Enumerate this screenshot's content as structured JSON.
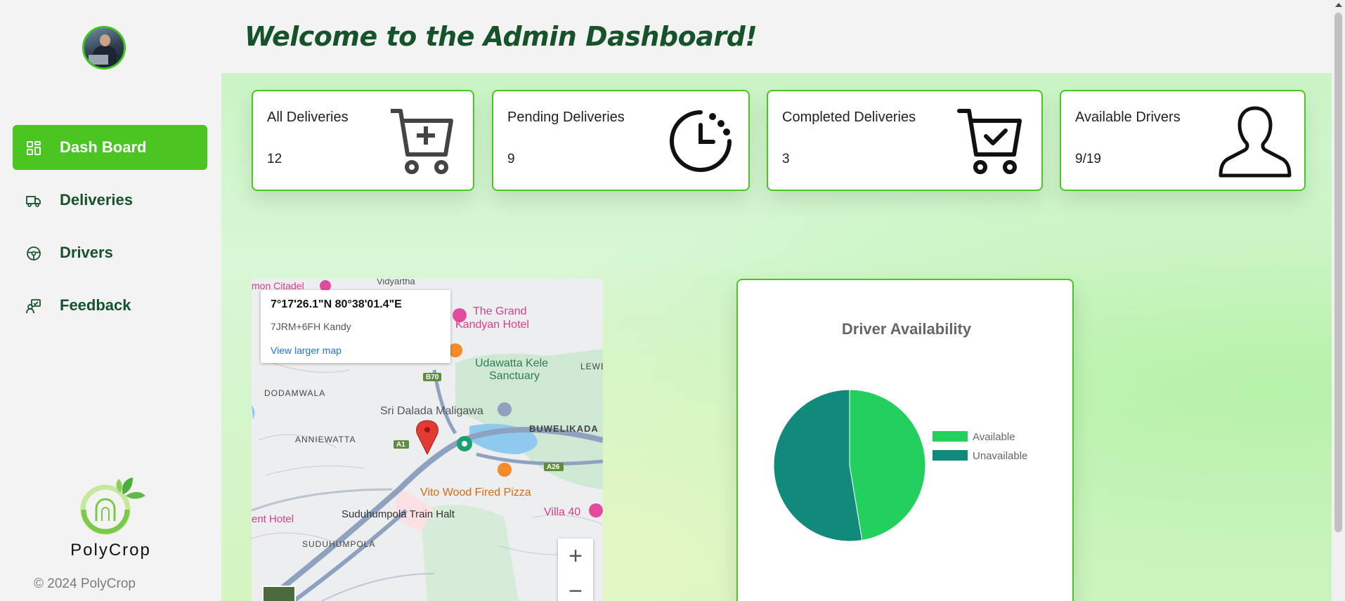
{
  "sidebar": {
    "nav": [
      {
        "label": "Dash Board",
        "icon": "dashboard-grid-icon",
        "active": true
      },
      {
        "label": "Deliveries",
        "icon": "truck-icon",
        "active": false
      },
      {
        "label": "Drivers",
        "icon": "steering-wheel-icon",
        "active": false
      },
      {
        "label": "Feedback",
        "icon": "feedback-person-icon",
        "active": false
      }
    ],
    "brand_name": "PolyCrop",
    "copyright": "© 2024 PolyCrop"
  },
  "header": {
    "title": "Welcome to the Admin Dashboard!"
  },
  "cards": [
    {
      "title": "All Deliveries",
      "value": "12",
      "icon": "cart-plus-icon"
    },
    {
      "title": "Pending Deliveries",
      "value": "9",
      "icon": "clock-icon"
    },
    {
      "title": "Completed Deliveries",
      "value": "3",
      "icon": "cart-check-icon"
    },
    {
      "title": "Available Drivers",
      "value": "9/19",
      "icon": "user-icon"
    }
  ],
  "map": {
    "coords": "7°17'26.1\"N 80°38'01.4\"E",
    "plus_code": "7JRM+6FH Kandy",
    "link": "View larger map",
    "zoom_in": "+",
    "zoom_out": "−",
    "labels": [
      {
        "text": "mon Citadel",
        "color": "#d6408b"
      },
      {
        "text": "Vidyartha",
        "color": "#555"
      },
      {
        "text": "The Grand",
        "color": "#d6408b"
      },
      {
        "text": "Kandyan Hotel",
        "color": "#d6408b"
      },
      {
        "text": "Udawatta Kele",
        "color": "#2f7d4f"
      },
      {
        "text": "Sanctuary",
        "color": "#2f7d4f"
      },
      {
        "text": "LEWE",
        "color": "#444"
      },
      {
        "text": "B70",
        "color": "#fff"
      },
      {
        "text": "DODAMWALA",
        "color": "#444"
      },
      {
        "text": "Sri Dalada Maligawa",
        "color": "#555"
      },
      {
        "text": "BUWELIKADA",
        "color": "#444"
      },
      {
        "text": "ANNIEWATTA",
        "color": "#444"
      },
      {
        "text": "A1",
        "color": "#fff"
      },
      {
        "text": "A26",
        "color": "#fff"
      },
      {
        "text": "Vito Wood Fired Pizza",
        "color": "#d26b12"
      },
      {
        "text": "Villa 40",
        "color": "#d6408b"
      },
      {
        "text": "ent Hotel",
        "color": "#d6408b"
      },
      {
        "text": "Suduhumpola Train Halt",
        "color": "#333"
      },
      {
        "text": "SUDUHUMPOLA",
        "color": "#444"
      }
    ]
  },
  "colors": {
    "accent": "#4ac522",
    "dark_green": "#17532a",
    "available": "#22d05d",
    "unavailable": "#118a7c"
  },
  "chart_data": {
    "type": "pie",
    "title": "Driver Availability",
    "categories": [
      "Available",
      "Unavailable"
    ],
    "values": [
      9,
      10
    ],
    "colors": [
      "#22d05d",
      "#118a7c"
    ],
    "legend": "right"
  }
}
